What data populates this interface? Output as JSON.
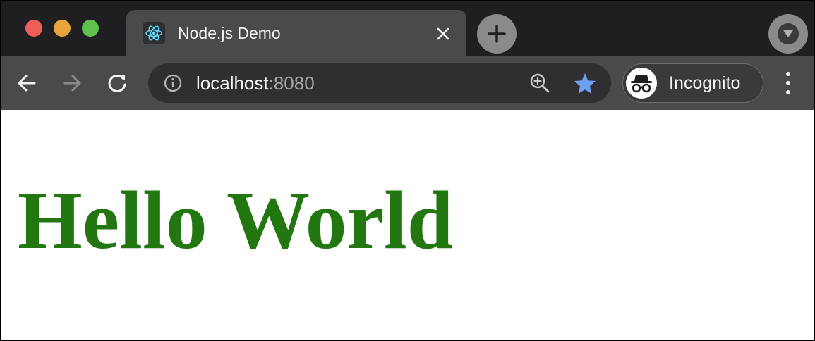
{
  "browser": {
    "tab": {
      "title": "Node.js Demo",
      "favicon": "react-icon"
    },
    "address_bar": {
      "host": "localhost",
      "port": ":8080"
    },
    "profile": {
      "label": "Incognito"
    },
    "icons": {
      "back": "arrow-left-icon",
      "forward": "arrow-right-icon",
      "reload": "reload-icon",
      "info": "info-icon",
      "zoom": "zoom-in-icon",
      "bookmark": "star-icon",
      "new_tab": "plus-icon",
      "tab_search": "chevron-down-icon",
      "menu": "kebab-menu-icon"
    },
    "colors": {
      "star": "#6e9ff0",
      "forward_disabled": "#8a8a8c"
    }
  },
  "page": {
    "heading": "Hello World",
    "heading_color": "#227711"
  }
}
